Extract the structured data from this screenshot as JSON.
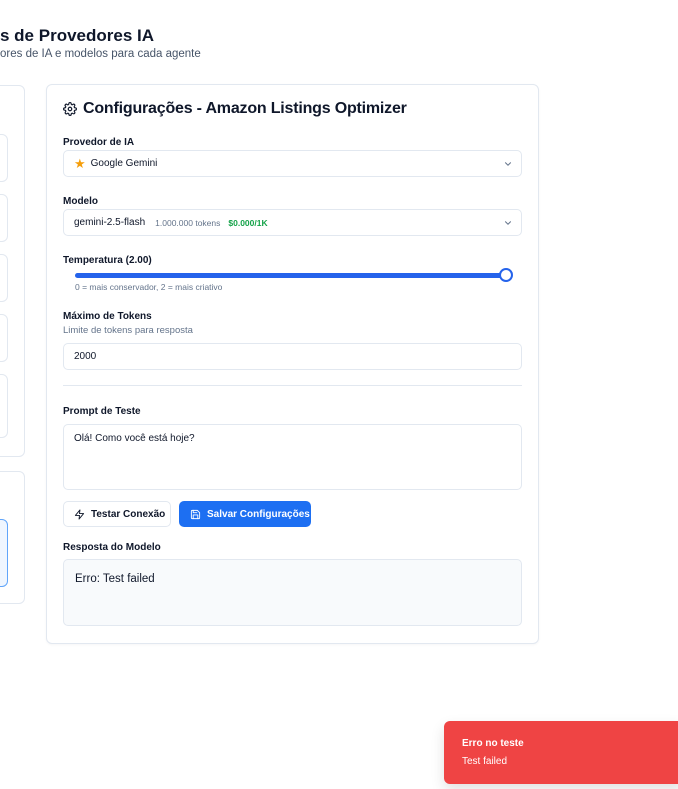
{
  "page": {
    "title": "s de Provedores IA",
    "subtitle": "ores de IA e modelos para cada agente"
  },
  "config_card": {
    "title": "Configurações - Amazon Listings Optimizer",
    "gear_icon": "gear-icon",
    "provider": {
      "label": "Provedor de IA",
      "icon": "star-icon",
      "value": "Google Gemini"
    },
    "model": {
      "label": "Modelo",
      "value": "gemini-2.5-flash",
      "tokens": "1.000.000 tokens",
      "price": "$0.000/1K",
      "price_color": "#16a34a"
    },
    "temperature": {
      "label": "Temperatura (2.00)",
      "value": 2.0,
      "min": 0,
      "max": 2,
      "hint": "0 = mais conservador, 2 = mais criativo"
    },
    "max_tokens": {
      "label": "Máximo de Tokens",
      "hint": "Limite de tokens para resposta",
      "value": "2000"
    },
    "test_prompt": {
      "label": "Prompt de Teste",
      "value": "Olá! Como você está hoje?"
    },
    "buttons": {
      "test_label": "Testar Conexão",
      "save_label": "Salvar Configurações"
    },
    "response": {
      "label": "Resposta do Modelo",
      "value": "Erro: Test failed"
    }
  },
  "toast": {
    "title": "Erro no teste",
    "description": "Test failed",
    "color": "#ef4444"
  },
  "colors": {
    "accent": "#1d6ff2",
    "slider": "#2563eb"
  }
}
